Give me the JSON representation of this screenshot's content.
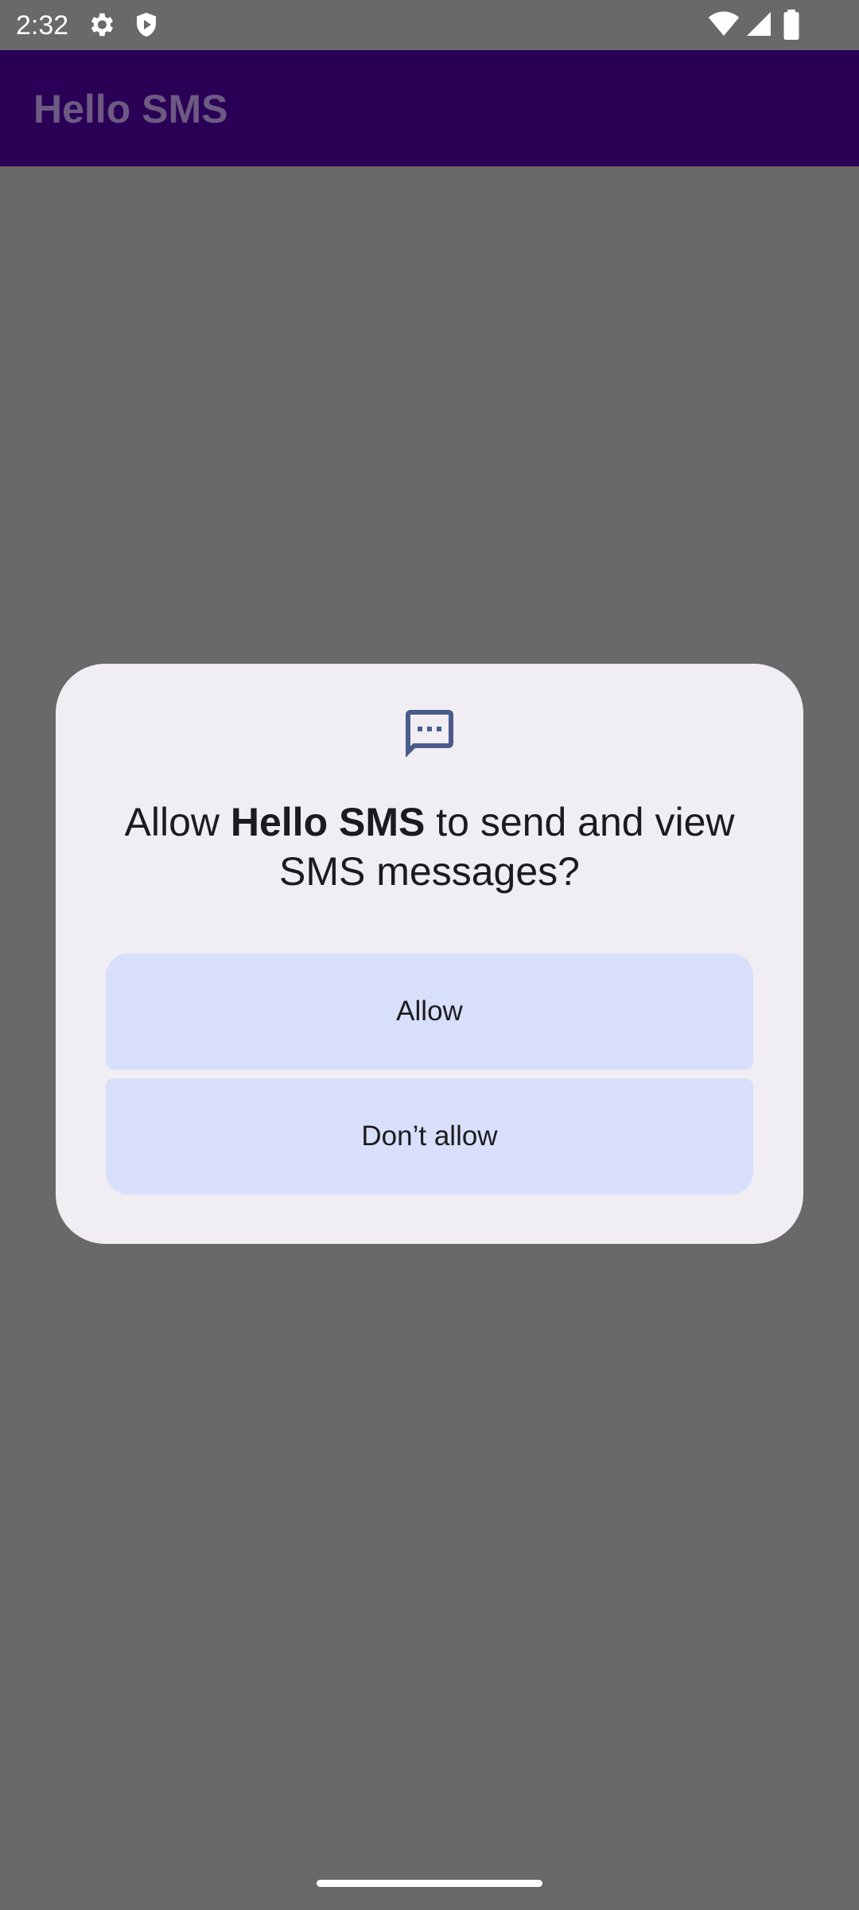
{
  "status_bar": {
    "time": "2:32",
    "icons": [
      "settings-gear-icon",
      "shield-icon",
      "wifi-icon",
      "cellular-signal-icon",
      "battery-icon"
    ]
  },
  "app_bar": {
    "title": "Hello SMS"
  },
  "dialog": {
    "icon": "sms-message-icon",
    "title_prefix": "Allow ",
    "app_name": "Hello SMS",
    "title_suffix": " to send and view SMS messages?",
    "allow_label": "Allow",
    "deny_label": "Don’t allow"
  },
  "colors": {
    "scrim_background": "#696969",
    "app_bar": "#2a0057",
    "dialog_surface": "#f0eef3",
    "button_fill": "#d8dffa",
    "icon_accent": "#4a5b8c"
  }
}
